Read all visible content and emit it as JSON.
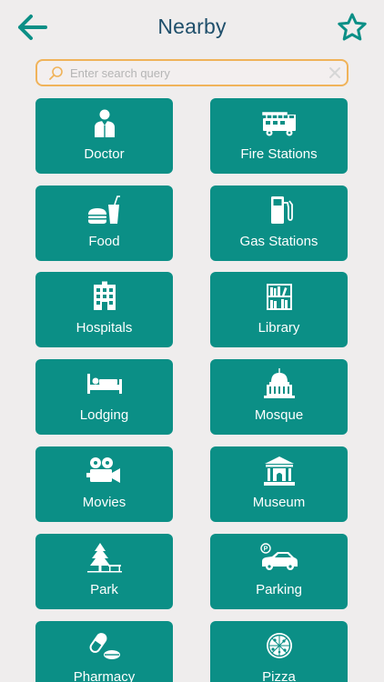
{
  "header": {
    "title": "Nearby",
    "back_icon": "arrow-left-icon",
    "favorite_icon": "star-outline-icon",
    "accent_color": "#0b8f86",
    "title_color": "#1f4f6b"
  },
  "search": {
    "placeholder": "Enter search query",
    "value": "",
    "border_color": "#f0b35a"
  },
  "categories": [
    {
      "label": "Doctor",
      "icon": "doctor-icon"
    },
    {
      "label": "Fire Stations",
      "icon": "fire-truck-icon"
    },
    {
      "label": "Food",
      "icon": "burger-drink-icon"
    },
    {
      "label": "Gas Stations",
      "icon": "gas-pump-icon"
    },
    {
      "label": "Hospitals",
      "icon": "hospital-building-icon"
    },
    {
      "label": "Library",
      "icon": "bookshelf-icon"
    },
    {
      "label": "Lodging",
      "icon": "bed-icon"
    },
    {
      "label": "Mosque",
      "icon": "dome-icon"
    },
    {
      "label": "Movies",
      "icon": "film-camera-icon"
    },
    {
      "label": "Museum",
      "icon": "museum-icon"
    },
    {
      "label": "Park",
      "icon": "tree-bench-icon"
    },
    {
      "label": "Parking",
      "icon": "parking-car-icon"
    },
    {
      "label": "Pharmacy",
      "icon": "pills-icon"
    },
    {
      "label": "Pizza",
      "icon": "pizza-icon"
    }
  ]
}
